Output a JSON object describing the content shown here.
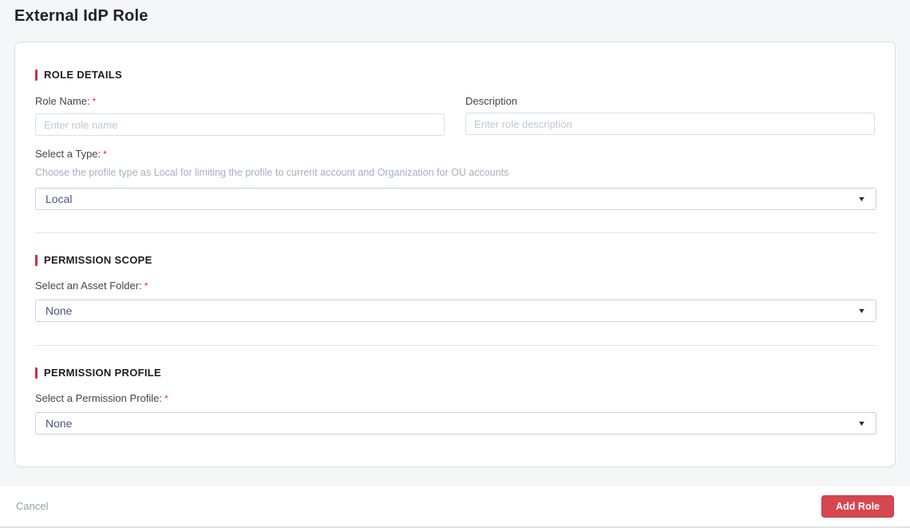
{
  "title": "External IdP Role",
  "icons": {
    "chevron_down": "▼"
  },
  "colors": {
    "accent_red": "#d2303e",
    "button_red": "#d6464f"
  },
  "role_details": {
    "heading": "ROLE DETAILS",
    "role_name_label": "Role Name:",
    "role_name_required": "*",
    "role_name_placeholder": "Enter role name",
    "description_label": "Description",
    "description_placeholder": "Enter role description",
    "type_label": "Select a Type:",
    "type_required": "*",
    "type_helper": "Choose the profile type as Local for limiting the profile to current account and Organization for OU accounts",
    "type_value": "Local"
  },
  "permission_scope": {
    "heading": "PERMISSION SCOPE",
    "asset_folder_label": "Select an Asset Folder:",
    "asset_folder_required": "*",
    "asset_folder_value": "None"
  },
  "permission_profile": {
    "heading": "PERMISSION PROFILE",
    "profile_label": "Select a Permission Profile:",
    "profile_required": "*",
    "profile_value": "None"
  },
  "footer": {
    "cancel_label": "Cancel",
    "submit_label": "Add Role"
  }
}
